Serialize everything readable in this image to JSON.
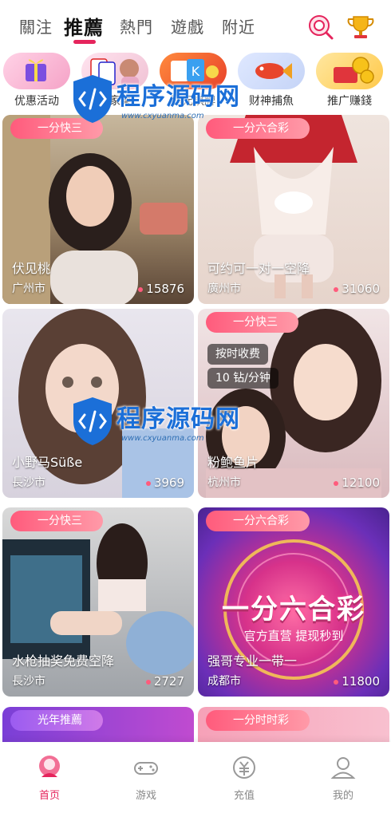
{
  "tabs": [
    {
      "label": "關注",
      "active": false
    },
    {
      "label": "推薦",
      "active": true
    },
    {
      "label": "熱門",
      "active": false
    },
    {
      "label": "遊戲",
      "active": false
    },
    {
      "label": "附近",
      "active": false
    }
  ],
  "header_icons": [
    "search-icon",
    "trophy-icon"
  ],
  "categories": [
    {
      "label": "优惠活动",
      "icon": "gift-icon"
    },
    {
      "label": "百家樂",
      "icon": "cards-icon"
    },
    {
      "label": "開元棋牌",
      "icon": "chess-icon"
    },
    {
      "label": "财神捕魚",
      "icon": "fish-icon"
    },
    {
      "label": "推广赚錢",
      "icon": "coin-icon"
    }
  ],
  "cards": [
    {
      "tag": "一分快三",
      "name": "伏见桃",
      "city": "广州市",
      "count": "15876"
    },
    {
      "tag": "一分六合彩",
      "name": "可约可一对一空降",
      "city": "廣州市",
      "count": "31060"
    },
    {
      "tag": "",
      "name": "小野马Süße",
      "city": "長沙市",
      "count": "3969"
    },
    {
      "tag": "一分快三",
      "name": "粉鲍鱼片",
      "city": "杭州市",
      "count": "12100",
      "pills": [
        "按时收费",
        "10 钻/分钟"
      ]
    },
    {
      "tag": "一分快三",
      "name": "水枪抽奖免费空降",
      "city": "長沙市",
      "count": "2727"
    },
    {
      "tag": "一分六合彩",
      "name": "强哥专业一带一",
      "city": "成都市",
      "count": "11800",
      "banner_title": "一分六合彩",
      "banner_sub": "官方直营 提现秒到"
    },
    {
      "tag": "光年推薦"
    },
    {
      "tag": "一分时时彩"
    }
  ],
  "watermark": {
    "title": "程序源码网",
    "url": "www.cxyuanma.com"
  },
  "bottom_nav": [
    {
      "label": "首页",
      "icon": "home-icon",
      "active": true
    },
    {
      "label": "游戏",
      "icon": "gamepad-icon",
      "active": false
    },
    {
      "label": "充值",
      "icon": "recharge-icon",
      "active": false
    },
    {
      "label": "我的",
      "icon": "profile-icon",
      "active": false
    }
  ],
  "colors": {
    "accent": "#e5245c",
    "tag": "#ff5b7c"
  }
}
